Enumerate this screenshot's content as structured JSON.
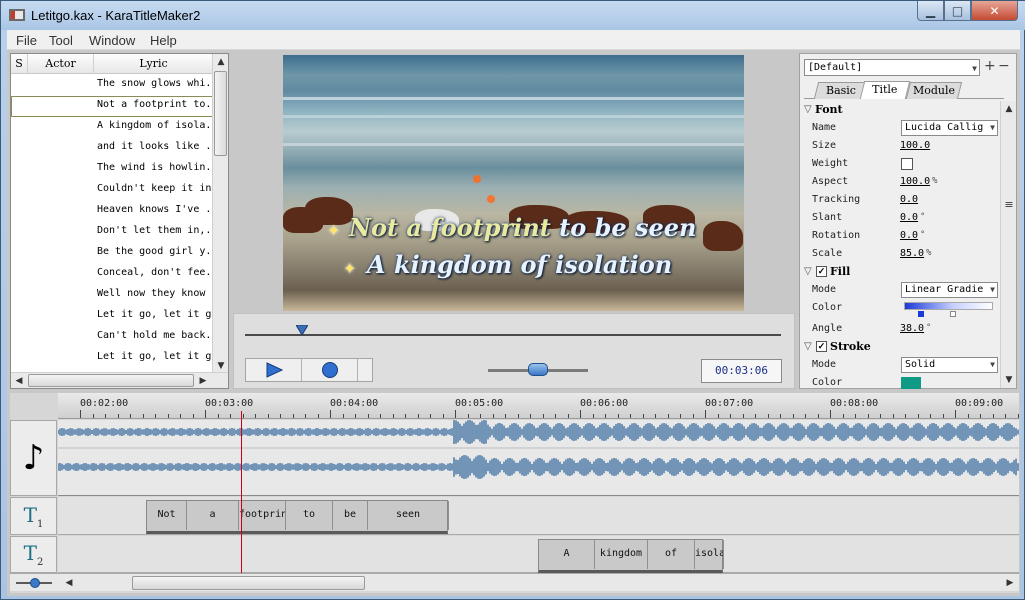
{
  "window": {
    "title": "Letitgo.kax - KaraTitleMaker2"
  },
  "menu": [
    "File",
    "Tool",
    "Window",
    "Help"
  ],
  "lyrics": {
    "columns": [
      "S",
      "Actor",
      "Lyric"
    ],
    "rows": [
      "The snow glows whi.",
      "Not a footprint to.",
      "A kingdom of isola.",
      "and it looks like .",
      "The wind is howlin.",
      "Couldn't keep it in",
      "Heaven knows I've .",
      "Don't let them in,.",
      "Be the good girl y.",
      "Conceal, don't fee.",
      "Well now they know ",
      "Let it go, let it g",
      "Can't hold me back.",
      "Let it go, let it g"
    ],
    "selected_index": 1
  },
  "preview": {
    "line1_highlight": "Not a footprint",
    "line1_rest": " to be seen",
    "line2": "A kingdom of isolation",
    "time": "00:03:06",
    "seek_position": 0.1,
    "volume": 0.5
  },
  "properties": {
    "preset": "[Default]",
    "tabs": [
      "Basic",
      "Title",
      "Module"
    ],
    "active_tab": "Title",
    "font_section": "Font",
    "font": [
      {
        "label": "Name",
        "value": "Lucida Callig",
        "kind": "combo"
      },
      {
        "label": "Size",
        "value": "100.0",
        "kind": "num",
        "unit": ""
      },
      {
        "label": "Weight",
        "value": "",
        "kind": "check"
      },
      {
        "label": "Aspect",
        "value": "100.0",
        "kind": "num",
        "unit": "%"
      },
      {
        "label": "Tracking",
        "value": "0.0",
        "kind": "num",
        "unit": ""
      },
      {
        "label": "Slant",
        "value": "0.0",
        "kind": "num",
        "unit": "°"
      },
      {
        "label": "Rotation",
        "value": "0.0",
        "kind": "num",
        "unit": "°"
      },
      {
        "label": "Scale",
        "value": "85.0",
        "kind": "num",
        "unit": "%"
      }
    ],
    "fill_section": "Fill",
    "fill": [
      {
        "label": "Mode",
        "value": "Linear Gradie",
        "kind": "combo"
      },
      {
        "label": "Color",
        "value": "",
        "kind": "gradient"
      },
      {
        "label": "Angle",
        "value": "38.0",
        "kind": "num",
        "unit": "°"
      }
    ],
    "stroke_section": "Stroke",
    "stroke": [
      {
        "label": "Mode",
        "value": "Solid",
        "kind": "combo"
      },
      {
        "label": "Color",
        "value": "",
        "kind": "swatch"
      }
    ],
    "colors": {
      "gradient_start": "#1b39d8",
      "gradient_end": "#ffffff",
      "stroke": "#0f9a86"
    }
  },
  "timeline": {
    "ticks": [
      "00:02:00",
      "00:03:00",
      "00:04:00",
      "00:05:00",
      "00:06:00",
      "00:07:00",
      "00:08:00",
      "00:09:00"
    ],
    "track1_words": [
      "Not",
      "a",
      "footprint",
      "to",
      "be",
      "seen"
    ],
    "track2_words": [
      "A",
      "kingdom",
      "of",
      "isolation"
    ],
    "playhead_time": "00:03:06",
    "accent": "#c8001c"
  }
}
